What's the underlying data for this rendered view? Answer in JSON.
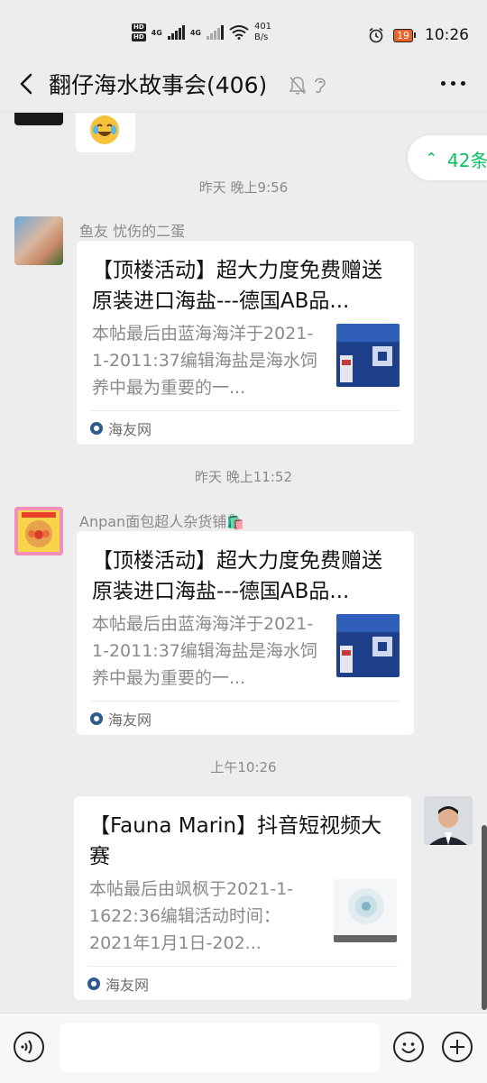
{
  "status_bar": {
    "hd1": "HD",
    "hd2": "HD",
    "net1": "4G",
    "net2": "4G",
    "speed_value": "401",
    "speed_unit": "B/s",
    "battery": "19",
    "time": "10:26"
  },
  "header": {
    "title": "翻仔海水故事会(406)"
  },
  "unread_pill": {
    "label": "42条"
  },
  "messages": [
    {
      "timestamp": "昨天 晚上9:56",
      "sender": "鱼友 忧伤的二蛋",
      "card": {
        "title": "【顶楼活动】超大力度免费赠送原装进口海盐---德国AB品...",
        "description": "本帖最后由蓝海海洋于2021-1-2011:37编辑海盐是海水饲养中最为重要的一...",
        "source": "海友网"
      }
    },
    {
      "timestamp": "昨天 晚上11:52",
      "sender": "Anpan面包超人杂货铺🛍️",
      "card": {
        "title": "【顶楼活动】超大力度免费赠送原装进口海盐---德国AB品...",
        "description": "本帖最后由蓝海海洋于2021-1-2011:37编辑海盐是海水饲养中最为重要的一...",
        "source": "海友网"
      }
    },
    {
      "timestamp": "上午10:26",
      "sender": "",
      "card": {
        "title": "【Fauna Marin】抖音短视频大赛",
        "description": "本帖最后由飒枫于2021-1-1622:36编辑活动时间：2021年1月1日-202...",
        "source": "海友网"
      }
    }
  ],
  "colors": {
    "background": "#ededed",
    "accent": "#07c160",
    "card": "#ffffff",
    "muted_text": "#8a8a8a"
  }
}
